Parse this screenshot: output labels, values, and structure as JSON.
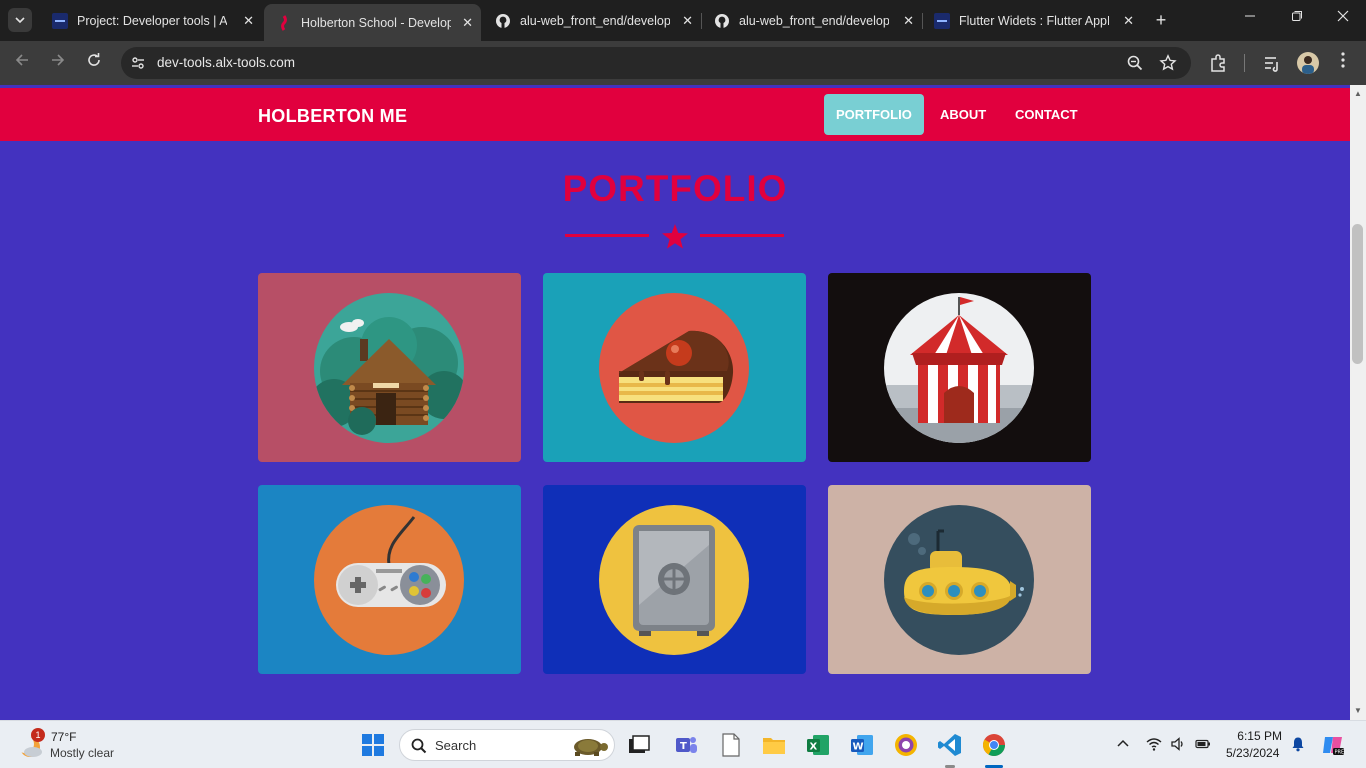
{
  "browser": {
    "tabs": [
      {
        "title": "Project: Developer tools | ALX",
        "favicon": "alx-favicon",
        "active": false
      },
      {
        "title": "Holberton School - Developer tools",
        "favicon": "holberton-favicon",
        "active": true
      },
      {
        "title": "alu-web_front_end/developer",
        "favicon": "github-favicon",
        "active": false
      },
      {
        "title": "alu-web_front_end/developer",
        "favicon": "github-favicon",
        "active": false
      },
      {
        "title": "Flutter Widets : Flutter AppBar",
        "favicon": "alx-favicon",
        "active": false
      }
    ],
    "close_glyph": "✕",
    "new_tab_glyph": "+",
    "url": "dev-tools.alx-tools.com"
  },
  "site": {
    "brand": "HOLBERTON ME",
    "menu": [
      {
        "label": "PORTFOLIO",
        "active": true
      },
      {
        "label": "ABOUT",
        "active": false
      },
      {
        "label": "CONTACT",
        "active": false
      }
    ],
    "section_title": "PORTFOLIO",
    "portfolio_items": [
      {
        "name": "cabin",
        "bg": "#b74f66"
      },
      {
        "name": "cake",
        "bg": "#1aa1b8"
      },
      {
        "name": "circus-tent",
        "bg": "#130e0e"
      },
      {
        "name": "game-controller",
        "bg": "#1b85c3"
      },
      {
        "name": "safe",
        "bg": "#0f2fb8"
      },
      {
        "name": "submarine",
        "bg": "#cdb2a6"
      }
    ],
    "colors": {
      "accent": "#e1003e",
      "page_bg": "#4332bf",
      "active_menu": "#79cfd3"
    }
  },
  "taskbar": {
    "weather": {
      "temp": "77°F",
      "desc": "Mostly clear",
      "badge": "1"
    },
    "search_label": "Search",
    "time": "6:15 PM",
    "date": "5/23/2024"
  }
}
